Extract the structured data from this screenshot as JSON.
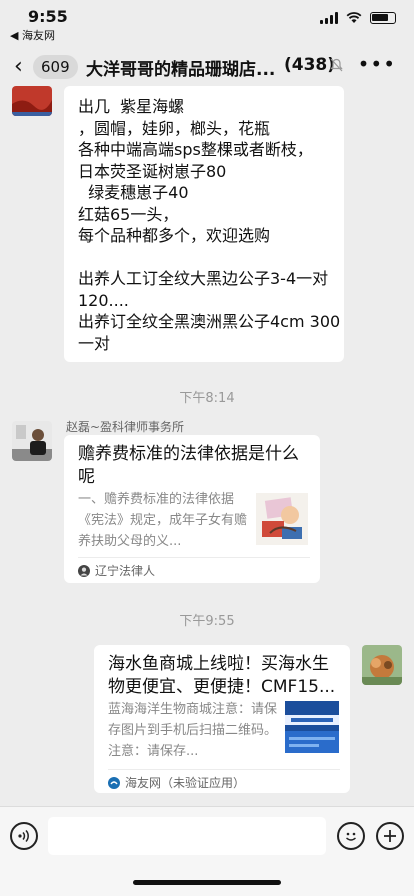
{
  "status_bar": {
    "time": "9:55",
    "back_app": "◀ 海友网"
  },
  "nav": {
    "back_symbol": "‹",
    "unread_count": "609",
    "title": "大洋哥哥的精品珊瑚店...",
    "member_count": "(438)"
  },
  "messages": {
    "first": {
      "text": "出几  紫星海螺\n，圆帽，娃卵，榔头，花瓶\n各种中端高端sps整棵或者断枝，\n日本荧圣诞树崽子80\n  绿麦穗崽子40\n红菇65一头，\n每个品种都多个，欢迎选购\n\n出养人工订全纹大黑边公子3-4一对120....\n出养订全纹全黑澳洲黑公子4cm 300一对"
    },
    "time1": "下午8:14",
    "second": {
      "sender": "赵磊~盈科律师事务所",
      "card_title": "赡养费标准的法律依据是什么呢",
      "card_desc": "一、赡养费标准的法律依据《宪法》规定，成年子女有赡养扶助父母的义...",
      "card_source": "辽宁法律人"
    },
    "time2": "下午9:55",
    "third": {
      "card_title": "海水鱼商城上线啦！买海水生物更便宜、更便捷！CMF15...",
      "card_desc": "蓝海海洋生物商城注意：请保存图片到手机后扫描二维码。注意：请保存...",
      "card_source": "海友网（未验证应用）"
    }
  },
  "input": {
    "placeholder": ""
  },
  "colors": {
    "background": "#ededed",
    "bubble": "#ffffff",
    "meta_text": "#999999"
  }
}
